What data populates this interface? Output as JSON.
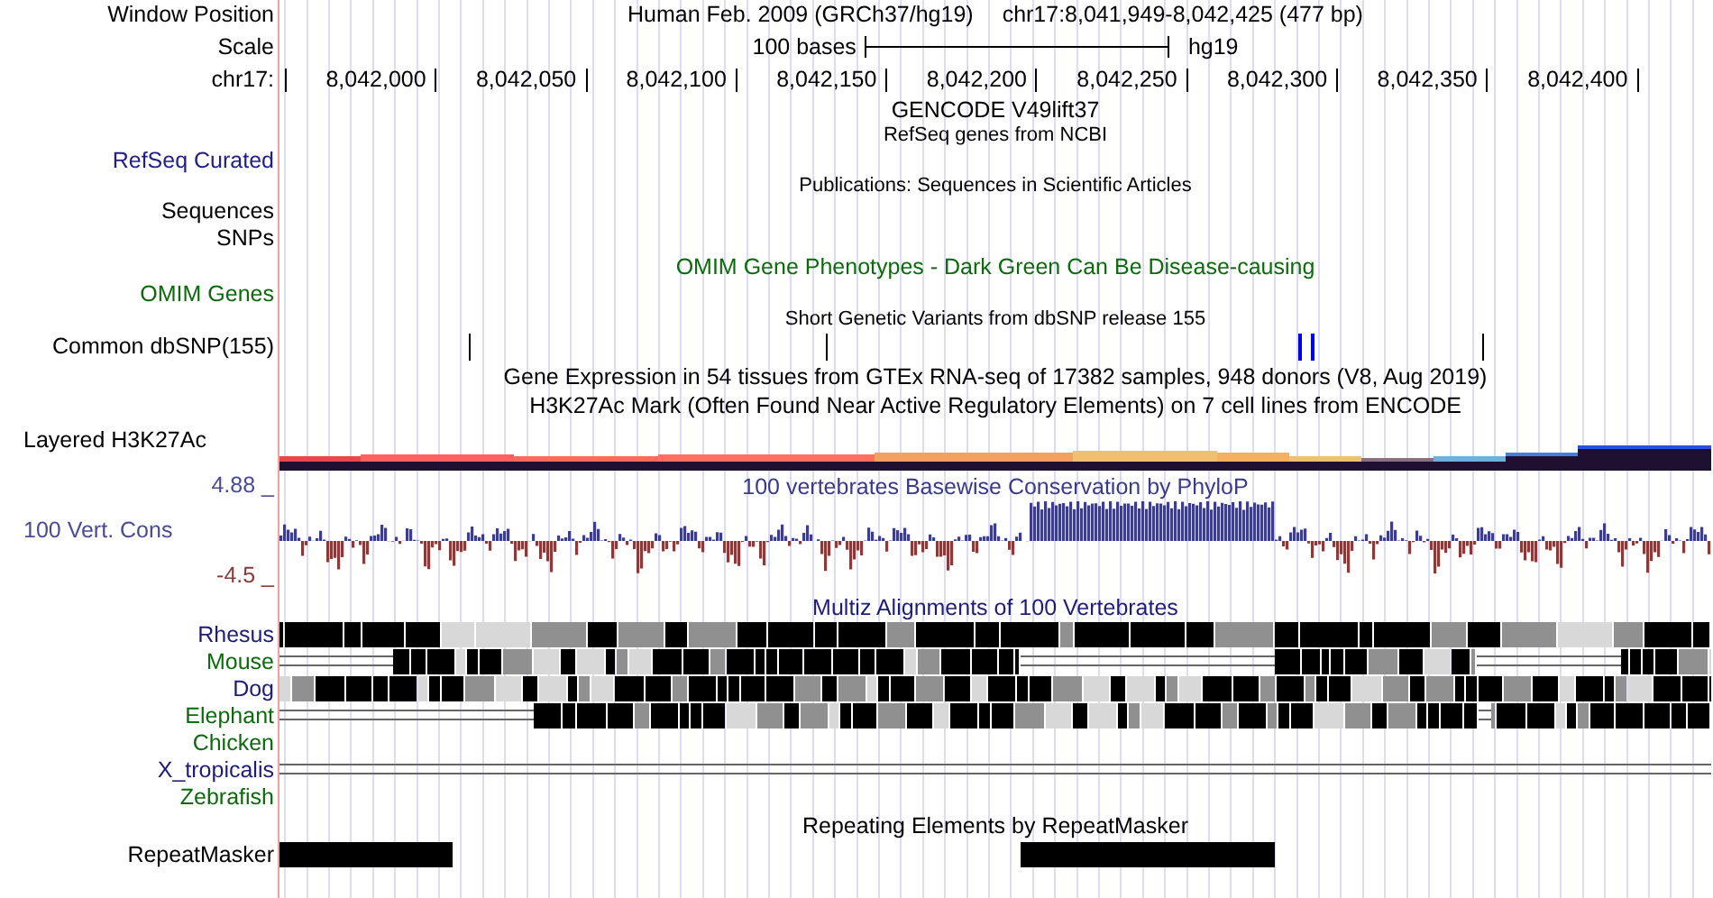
{
  "header": {
    "label": "Window Position",
    "assembly": "Human Feb. 2009 (GRCh37/hg19)",
    "position": "chr17:8,041,949-8,042,425 (477 bp)"
  },
  "scale": {
    "label": "Scale",
    "length": "100 bases",
    "assembly": "hg19"
  },
  "ruler": {
    "label": "chr17:",
    "ticks": [
      "8,042,000",
      "8,042,050",
      "8,042,100",
      "8,042,150",
      "8,042,200",
      "8,042,250",
      "8,042,300",
      "8,042,350",
      "8,042,400"
    ]
  },
  "tracks": [
    {
      "kind": "title",
      "text": "GENCODE V49lift37",
      "color": "#000000"
    },
    {
      "kind": "note",
      "text": "RefSeq genes from NCBI",
      "color": "#000000"
    },
    {
      "kind": "label",
      "label": "RefSeq Curated",
      "color": "#20208c"
    },
    {
      "kind": "note",
      "text": "Publications: Sequences in Scientific Articles",
      "color": "#000000"
    },
    {
      "kind": "label",
      "label": "Sequences",
      "color": "#000000"
    },
    {
      "kind": "label",
      "label": "SNPs",
      "color": "#000000"
    },
    {
      "kind": "title",
      "text": "OMIM Gene Phenotypes - Dark Green Can Be Disease-causing",
      "color": "#0b6b0b"
    },
    {
      "kind": "label",
      "label": "OMIM Genes",
      "color": "#0b6b0b"
    },
    {
      "kind": "note",
      "text": "Short Genetic Variants from dbSNP release 155",
      "color": "#000000"
    },
    {
      "kind": "snp",
      "label": "Common dbSNP(155)",
      "color": "#000000"
    },
    {
      "kind": "title",
      "text": "Gene Expression in 54 tissues from GTEx RNA-seq of 17382 samples, 948 donors (V8, Aug 2019)",
      "color": "#000000"
    },
    {
      "kind": "title",
      "text": "H3K27Ac Mark (Often Found Near Active Regulatory Elements) on 7 cell lines from ENCODE",
      "color": "#000000"
    },
    {
      "kind": "layered",
      "label": "Layered H3K27Ac",
      "color": "#000000"
    },
    {
      "kind": "conservation",
      "title": {
        "text": "100 vertebrates Basewise Conservation by PhyloP",
        "color": "#3a3a8c"
      },
      "label": "100 Vert. Cons",
      "color": "#4a4a9a",
      "max": {
        "text": "4.88 _",
        "color": "#4a4a9a"
      },
      "min": {
        "text": "-4.5 _",
        "color": "#8b3a3a"
      }
    },
    {
      "kind": "title",
      "text": "Multiz Alignments of 100 Vertebrates",
      "color": "#1c1c7a"
    },
    {
      "kind": "species",
      "label": "Rhesus",
      "color": "#1c1c7a"
    },
    {
      "kind": "species",
      "label": "Mouse",
      "color": "#0b6b0b"
    },
    {
      "kind": "species",
      "label": "Dog",
      "color": "#1c1c7a"
    },
    {
      "kind": "species",
      "label": "Elephant",
      "color": "#0b6b0b"
    },
    {
      "kind": "species",
      "label": "Chicken",
      "color": "#0b6b0b"
    },
    {
      "kind": "species",
      "label": "X_tropicalis",
      "color": "#1c1c7a"
    },
    {
      "kind": "species",
      "label": "Zebrafish",
      "color": "#0b6b0b"
    },
    {
      "kind": "title",
      "text": "Repeating Elements by RepeatMasker",
      "color": "#000000"
    },
    {
      "kind": "repeat",
      "label": "RepeatMasker",
      "color": "#000000"
    }
  ]
}
